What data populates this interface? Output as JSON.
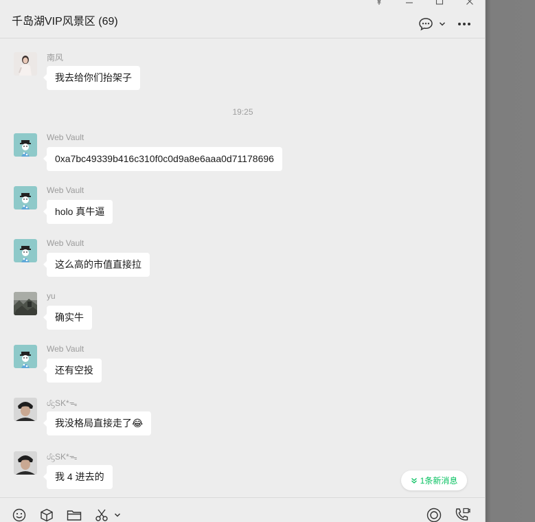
{
  "header": {
    "title": "千岛湖VIP风景区 (69)"
  },
  "messages": [
    {
      "kind": "msg",
      "sender": "南风",
      "text": "我去给你们抬架子",
      "avatar": "person-photo-avatar"
    },
    {
      "kind": "time",
      "text": "19:25"
    },
    {
      "kind": "msg",
      "sender": "Web Vault",
      "text": "0xa7bc49339b416c310f0c0d9a8e6aaa0d71178696",
      "avatar": "cartoon-avatar"
    },
    {
      "kind": "msg",
      "sender": "Web Vault",
      "text": "holo 真牛逼",
      "avatar": "cartoon-avatar"
    },
    {
      "kind": "msg",
      "sender": "Web Vault",
      "text": "这么高的市值直接拉",
      "avatar": "cartoon-avatar"
    },
    {
      "kind": "msg",
      "sender": "yu",
      "text": "确实牛",
      "avatar": "landscape-avatar"
    },
    {
      "kind": "msg",
      "sender": "Web Vault",
      "text": "还有空投",
      "avatar": "cartoon-avatar"
    },
    {
      "kind": "msg",
      "sender": "ᦔᦓSK*ᯓ",
      "text": "我没格局直接走了",
      "emoji": "😂",
      "avatar": "dark-photo-avatar"
    },
    {
      "kind": "msg",
      "sender": "ᦔᦓSK*ᯓ",
      "text": "我 4 进去的",
      "avatar": "dark-photo-avatar"
    }
  ],
  "new_message_badge": "1条新消息",
  "colors": {
    "window_bg": "#ededed",
    "bubble_bg": "#ffffff",
    "accent_green": "#07c160",
    "sender_gray": "#9b9b9b",
    "desktop_gray": "#7f7f7f"
  },
  "icons": {
    "window_controls": [
      "pin-icon",
      "minimize-icon",
      "maximize-icon",
      "close-icon"
    ],
    "header": [
      "chat-bubble-icon",
      "chevron-down-icon",
      "more-icon"
    ],
    "toolbar_left": [
      "emoji-icon",
      "cube-icon",
      "folder-icon",
      "scissors-icon",
      "chevron-down-icon"
    ],
    "toolbar_right": [
      "live-icon",
      "phone-icon"
    ]
  }
}
